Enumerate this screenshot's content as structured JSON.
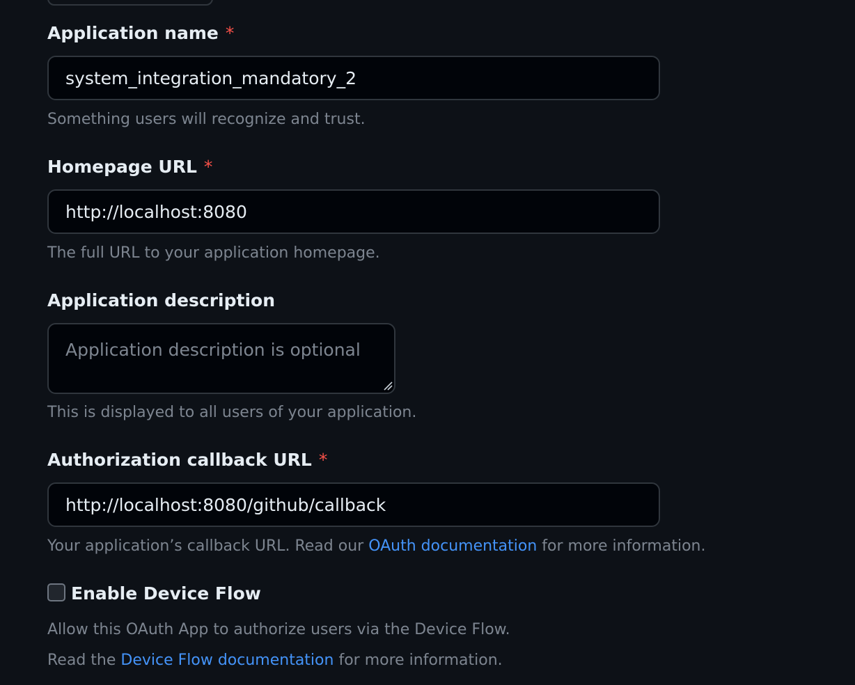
{
  "fields": {
    "app_name": {
      "label": "Application name",
      "required_mark": "*",
      "value": "system_integration_mandatory_2",
      "hint": "Something users will recognize and trust."
    },
    "homepage_url": {
      "label": "Homepage URL",
      "required_mark": "*",
      "value": "http://localhost:8080",
      "hint": "The full URL to your application homepage."
    },
    "description": {
      "label": "Application description",
      "placeholder": "Application description is optional",
      "hint": "This is displayed to all users of your application."
    },
    "callback_url": {
      "label": "Authorization callback URL",
      "required_mark": "*",
      "value": "http://localhost:8080/github/callback",
      "hint_prefix": "Your application’s callback URL. Read our ",
      "hint_link": "OAuth documentation",
      "hint_suffix": " for more information."
    }
  },
  "device_flow": {
    "label": "Enable Device Flow",
    "checked": false,
    "hint1": "Allow this OAuth App to authorize users via the Device Flow.",
    "hint2_prefix": "Read the ",
    "hint2_link": "Device Flow documentation",
    "hint2_suffix": " for more information."
  },
  "colors": {
    "background": "#0d1117",
    "input_bg": "#010409",
    "border": "#30363d",
    "text": "#e6edf3",
    "muted": "#7d8590",
    "link": "#4493f8",
    "required": "#f85149"
  }
}
